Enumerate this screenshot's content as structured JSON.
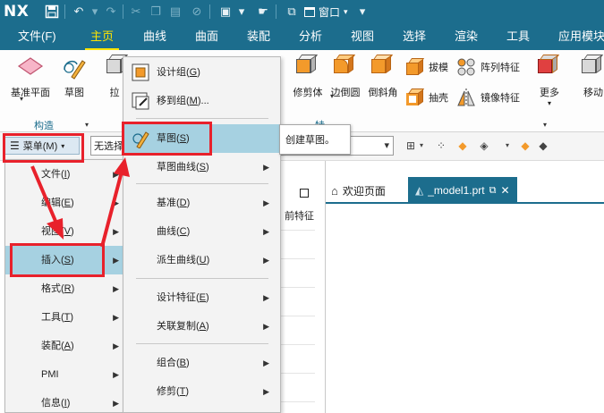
{
  "app": {
    "logo": "NX",
    "window_menu_label": "窗口"
  },
  "menubar": {
    "tabs": [
      {
        "label": "文件(F)"
      },
      {
        "label": "主页"
      },
      {
        "label": "曲线"
      },
      {
        "label": "曲面"
      },
      {
        "label": "装配"
      },
      {
        "label": "分析"
      },
      {
        "label": "视图"
      },
      {
        "label": "选择"
      },
      {
        "label": "渲染"
      },
      {
        "label": "工具"
      },
      {
        "label": "应用模块"
      }
    ],
    "active_tab": "主页"
  },
  "ribbon": {
    "datum_plane": "基准平面",
    "sketch": "草图",
    "extrude_partial": "拉",
    "group_construct": "构造",
    "group_feature_partial": "特",
    "trim_body": "修剪体",
    "edge_blend": "边倒圆",
    "chamfer": "倒斜角",
    "draft": "拔模",
    "shell": "抽壳",
    "pattern_feature": "阵列特征",
    "mirror_feature": "镜像特征",
    "more": "更多",
    "move_partial": "移动"
  },
  "toolbar": {
    "menu_button": "菜单(M)",
    "selection_filter": "无选择"
  },
  "left_panel": {
    "column_header": "前特征"
  },
  "doc_tabs": {
    "welcome": "欢迎页面",
    "model": "_model1.prt"
  },
  "main_menu": {
    "items": [
      {
        "label": "文件(I)",
        "underline_key": "I"
      },
      {
        "label": "编辑(E)",
        "underline_key": "E"
      },
      {
        "label": "视图(V)",
        "underline_key": "V"
      },
      {
        "label": "插入(S)",
        "underline_key": "S"
      },
      {
        "label": "格式(R)",
        "underline_key": "R"
      },
      {
        "label": "工具(T)",
        "underline_key": "T"
      },
      {
        "label": "装配(A)",
        "underline_key": "A"
      },
      {
        "label": "PMI",
        "underline_key": "M"
      },
      {
        "label": "信息(I)",
        "underline_key": "I"
      }
    ],
    "highlighted": "插入(S)"
  },
  "insert_menu": {
    "items": [
      {
        "label": "设计组(G)"
      },
      {
        "label": "移到组(M)..."
      },
      {
        "label": "草图(S)"
      },
      {
        "label": "草图曲线(S)"
      },
      {
        "label": "基准(D)"
      },
      {
        "label": "曲线(C)"
      },
      {
        "label": "派生曲线(U)"
      },
      {
        "label": "设计特征(E)"
      },
      {
        "label": "关联复制(A)"
      },
      {
        "label": "组合(B)"
      },
      {
        "label": "修剪(T)"
      }
    ],
    "highlighted": "草图(S)"
  },
  "tooltip": {
    "text": "创建草图。"
  },
  "colors": {
    "titlebar": "#1c6d8d",
    "active_tab": "#ffe400",
    "highlight": "#a6d1e1",
    "annotation_red": "#e8212b",
    "icon_orange": "#f39a2b"
  }
}
